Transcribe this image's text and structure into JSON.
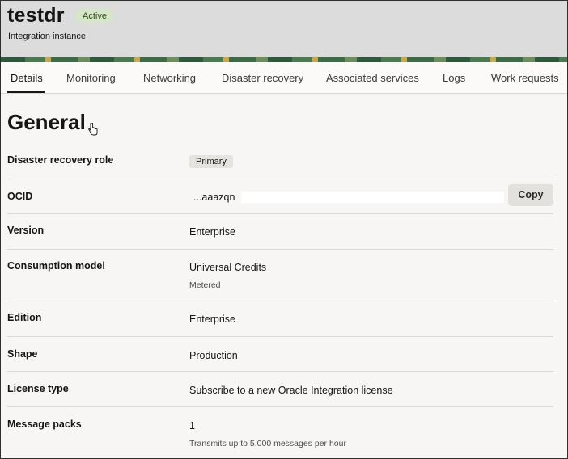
{
  "header": {
    "title": "testdr",
    "status": "Active",
    "subtitle": "Integration instance"
  },
  "tabs": [
    {
      "label": "Details",
      "active": true
    },
    {
      "label": "Monitoring"
    },
    {
      "label": "Networking"
    },
    {
      "label": "Disaster recovery"
    },
    {
      "label": "Associated services"
    },
    {
      "label": "Logs"
    },
    {
      "label": "Work requests"
    }
  ],
  "section": {
    "title": "General"
  },
  "details": {
    "dr_role": {
      "label": "Disaster recovery role",
      "value": "Primary"
    },
    "ocid": {
      "label": "OCID",
      "value": "...aaazqn",
      "copy_label": "Copy"
    },
    "version": {
      "label": "Version",
      "value": "Enterprise"
    },
    "consumption": {
      "label": "Consumption model",
      "value": "Universal Credits",
      "sub": "Metered"
    },
    "edition": {
      "label": "Edition",
      "value": "Enterprise"
    },
    "shape": {
      "label": "Shape",
      "value": "Production"
    },
    "license": {
      "label": "License type",
      "value": "Subscribe to a new Oracle Integration license"
    },
    "message_packs": {
      "label": "Message packs",
      "value": "1",
      "sub": "Transmits up to 5,000 messages per hour"
    }
  }
}
